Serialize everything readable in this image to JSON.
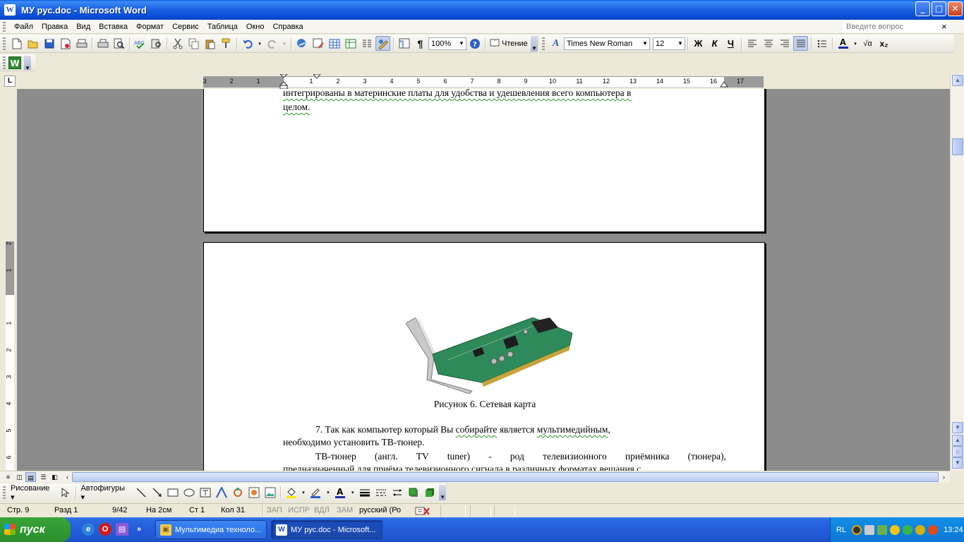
{
  "window": {
    "title": "МУ рус.doc - Microsoft Word",
    "app_icon_letter": "W",
    "min_glyph": "_",
    "max_glyph": "□",
    "close_glyph": "✕"
  },
  "menubar": {
    "items": [
      "Файл",
      "Правка",
      "Вид",
      "Вставка",
      "Формат",
      "Сервис",
      "Таблица",
      "Окно",
      "Справка"
    ],
    "ask_placeholder": "Введите вопрос",
    "close_doc_glyph": "×"
  },
  "toolbar_standard": {
    "zoom": "100%",
    "reading_label": "Чтение",
    "pilcrow": "¶"
  },
  "toolbar_format": {
    "font_name": "Times New Roman",
    "font_size": "12",
    "bold": "Ж",
    "italic": "К",
    "underline": "Ч",
    "font_color_glyph": "A",
    "subscript": "x₂",
    "sqrt_glyph": "√α",
    "style_glyph": "A"
  },
  "toolbar_extra": {
    "logo_letter": "W"
  },
  "ruler": {
    "tab_selector": "L",
    "numbers_left": [
      "3",
      "2",
      "1"
    ],
    "numbers_right": [
      "1",
      "2",
      "3",
      "4",
      "5",
      "6",
      "7",
      "8",
      "9",
      "10",
      "11",
      "12",
      "13",
      "14",
      "15",
      "16",
      "17"
    ],
    "vertical_numbers": [
      "2",
      "1",
      "1",
      "2",
      "3",
      "4",
      "5",
      "6"
    ]
  },
  "document": {
    "page1_line1": "интегрированы в материнские платы для удобства и удешевления всего компьютера в",
    "page1_line2": "целом.",
    "figure_caption": "Рисунок 6. Сетевая карта",
    "para1_a": "7. Так как компьютер который Вы ",
    "para1_b": "собирайте",
    "para1_c": " является ",
    "para1_d": "мультимедийным",
    "para1_e": ",",
    "para1_line2": "необходимо установить ТВ-тюнер.",
    "para2_line1": "ТВ-тюнер (англ. TV tuner) - род телевизионного приёмника (тюнера),",
    "para2_line2": "предназначенный для приёма телевизионного сигнала в различных форматах вещания с"
  },
  "drawing_toolbar": {
    "drawing_label": "Рисование ▾",
    "autoshapes_label": "Автофигуры ▾"
  },
  "statusbar": {
    "page": "Стр. 9",
    "section": "Разд 1",
    "pages": "9/42",
    "at": "На 2см",
    "line": "Ст 1",
    "col": "Кол 31",
    "rec": "ЗАП",
    "trk": "ИСПР",
    "ext": "ВДЛ",
    "ovr": "ЗАМ",
    "language": "русский (Ро"
  },
  "taskbar": {
    "start_label": "пуск",
    "tasks": [
      {
        "label": "Мультимедиа техноло...",
        "active": false
      },
      {
        "label": "МУ рус.doc - Microsoft...",
        "active": true
      }
    ],
    "tray_lang": "RL",
    "clock": "13:24"
  },
  "colors": {
    "titlebar": "#0a4fd6",
    "doc_background": "#8c8c8c",
    "taskbar": "#245dd8",
    "grammar_squiggle": "#2e8f2e"
  }
}
